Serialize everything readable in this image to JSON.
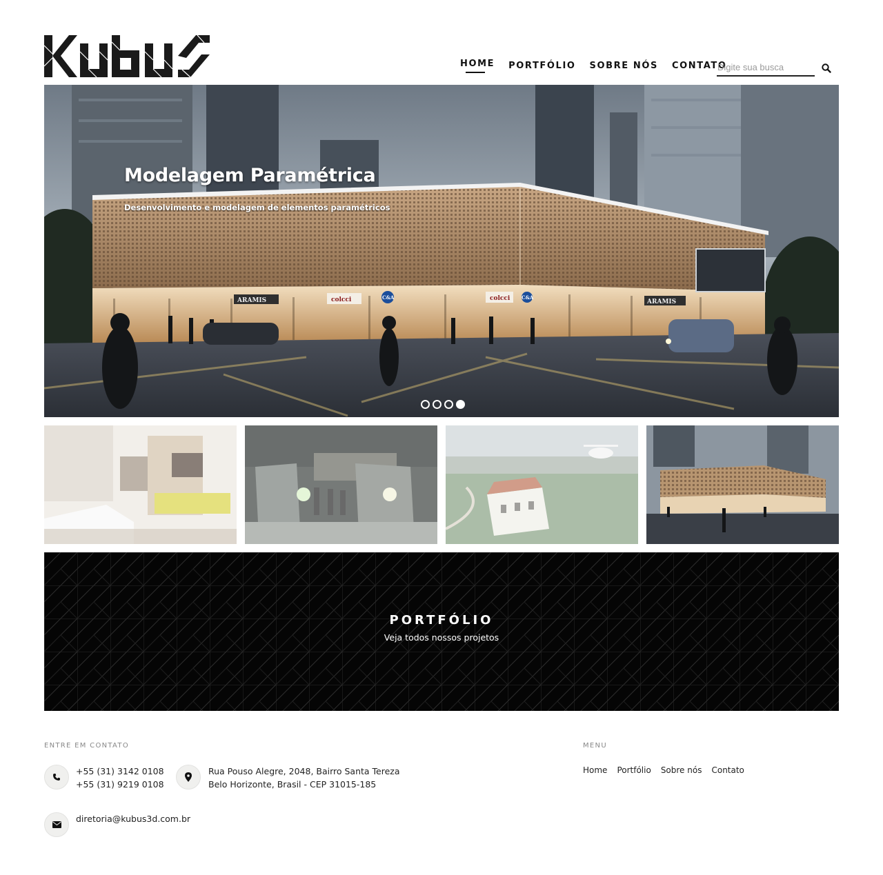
{
  "brand": {
    "logo_text": "kubus"
  },
  "nav": {
    "items": [
      "HOME",
      "PORTFÓLIO",
      "SOBRE NÓS",
      "CONTATO"
    ],
    "active": "HOME"
  },
  "search": {
    "placeholder": "Digite sua busca",
    "icon": "search-icon"
  },
  "hero": {
    "title": "Modelagem Paramétrica",
    "subtitle": "Desenvolvimento e modelagem de elementos paramétricos",
    "slide_count": 4,
    "active_slide": 4,
    "signs": [
      "ARAMIS",
      "colcci",
      "C&A",
      "colcci",
      "C&A",
      "ARAMIS"
    ]
  },
  "portfolio_band": {
    "title": "PORTFÓLIO",
    "subtitle": "Veja todos nossos projetos"
  },
  "footer": {
    "contact_heading": "ENTRE EM CONTATO",
    "phone_1": "+55 (31) 3142 0108",
    "phone_2": "+55 (31) 9219 0108",
    "address_1": "Rua Pouso Alegre, 2048, Bairro Santa Tereza",
    "address_2": "Belo Horizonte, Brasil - CEP 31015-185",
    "email": "diretoria@kubus3d.com.br",
    "menu_heading": "MENU",
    "menu_items": [
      "Home",
      "Portfólio",
      "Sobre nós",
      "Contato"
    ],
    "icons": [
      "phone-icon",
      "map-pin-icon",
      "envelope-icon"
    ]
  },
  "colors": {
    "text": "#222222",
    "band": "#050505",
    "accent": "#111111"
  }
}
